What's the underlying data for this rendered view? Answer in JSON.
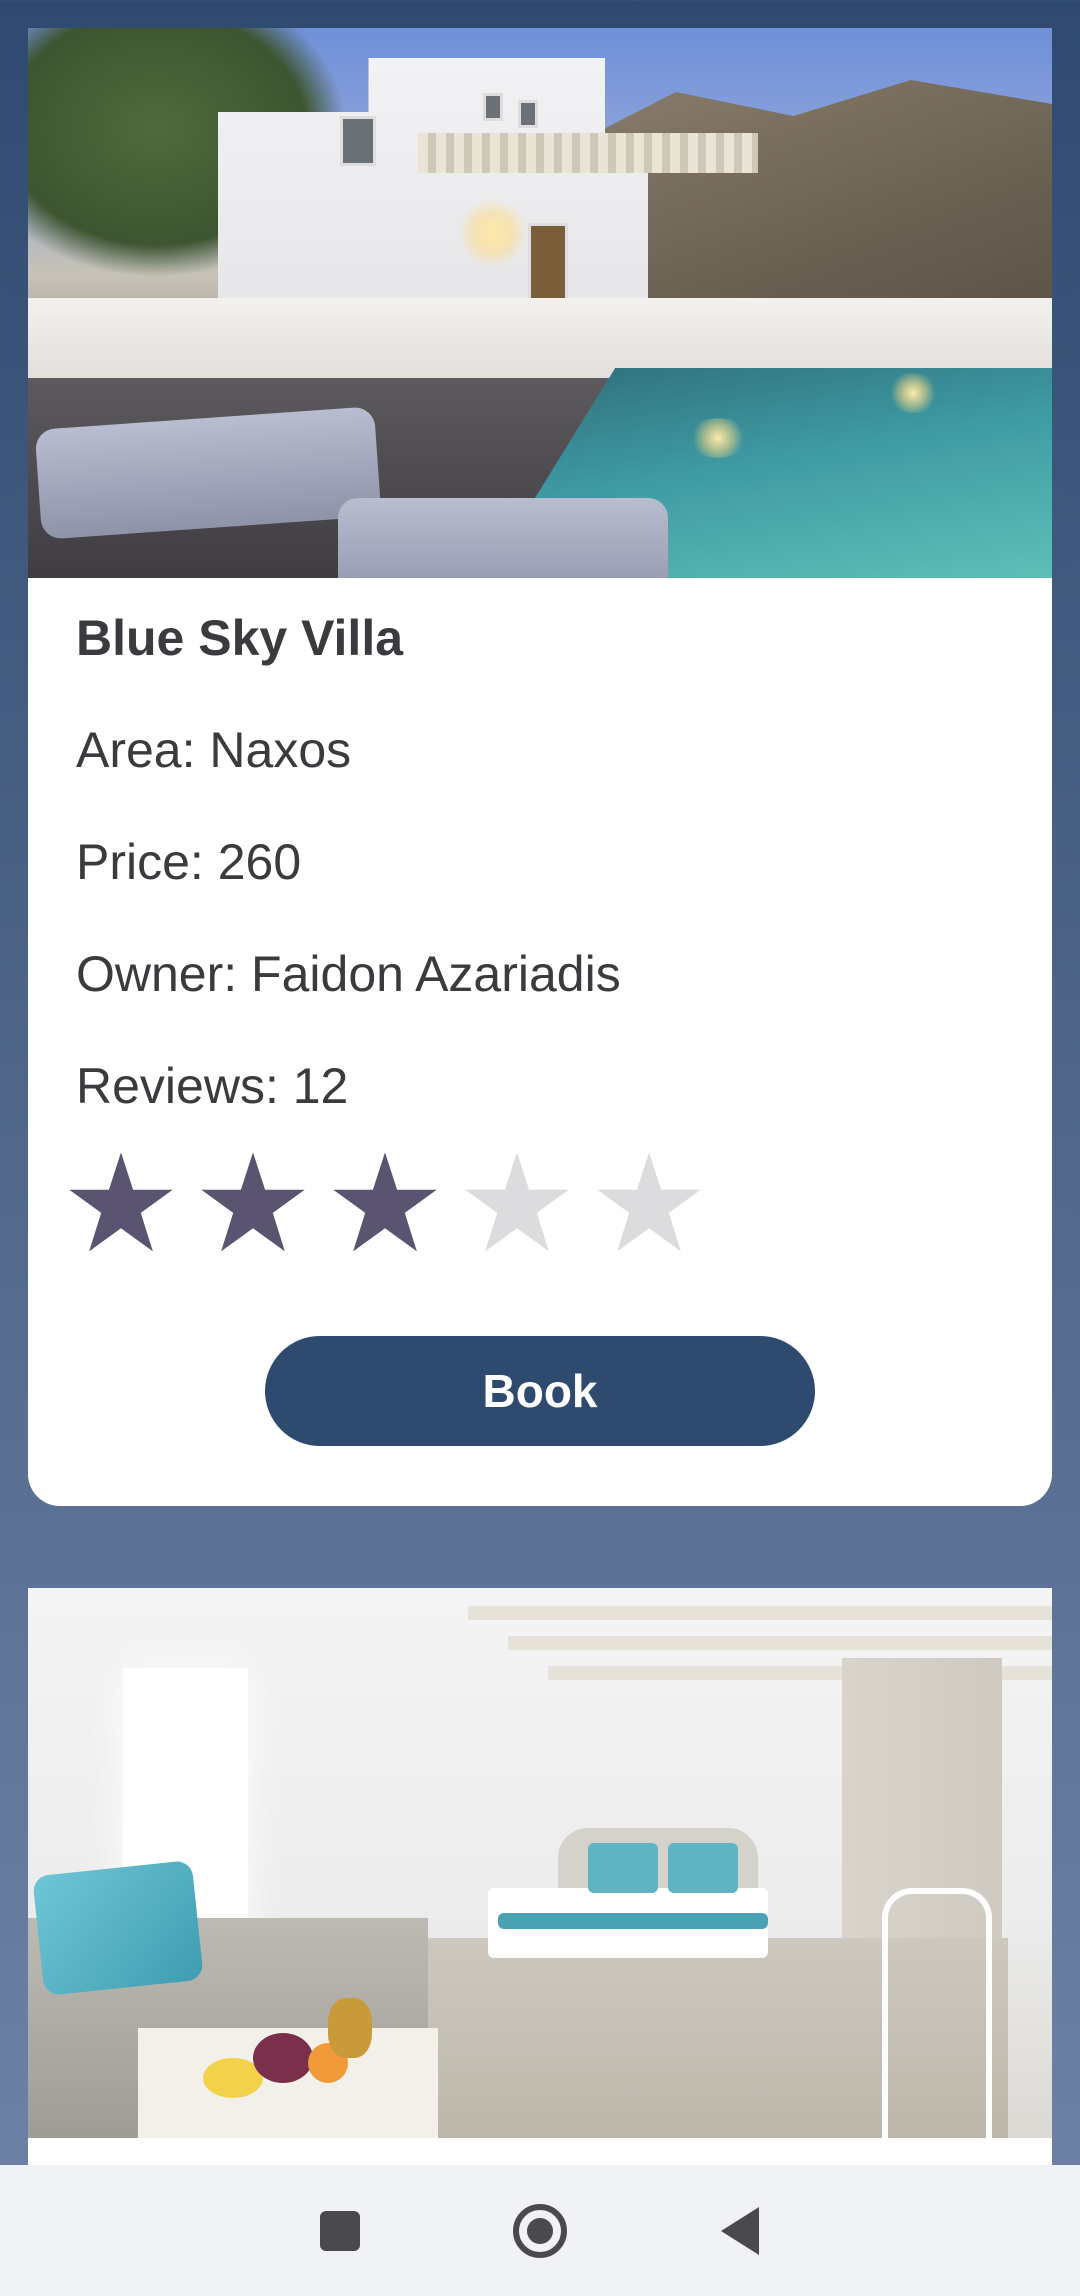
{
  "listings": [
    {
      "name": "Blue Sky Villa",
      "area": "Area: Naxos",
      "price": "Price: 260",
      "owner": "Owner: Faidon Azariadis",
      "reviews": "Reviews: 12",
      "rating": 3,
      "rating_max": 5,
      "book_label": "Book"
    }
  ],
  "colors": {
    "star_filled": "#5a5470",
    "star_empty": "#dcdcdf",
    "book_button": "#2e4a6e"
  },
  "nav": {
    "recents_icon": "square-icon",
    "home_icon": "circle-home-icon",
    "back_icon": "triangle-back-icon"
  }
}
